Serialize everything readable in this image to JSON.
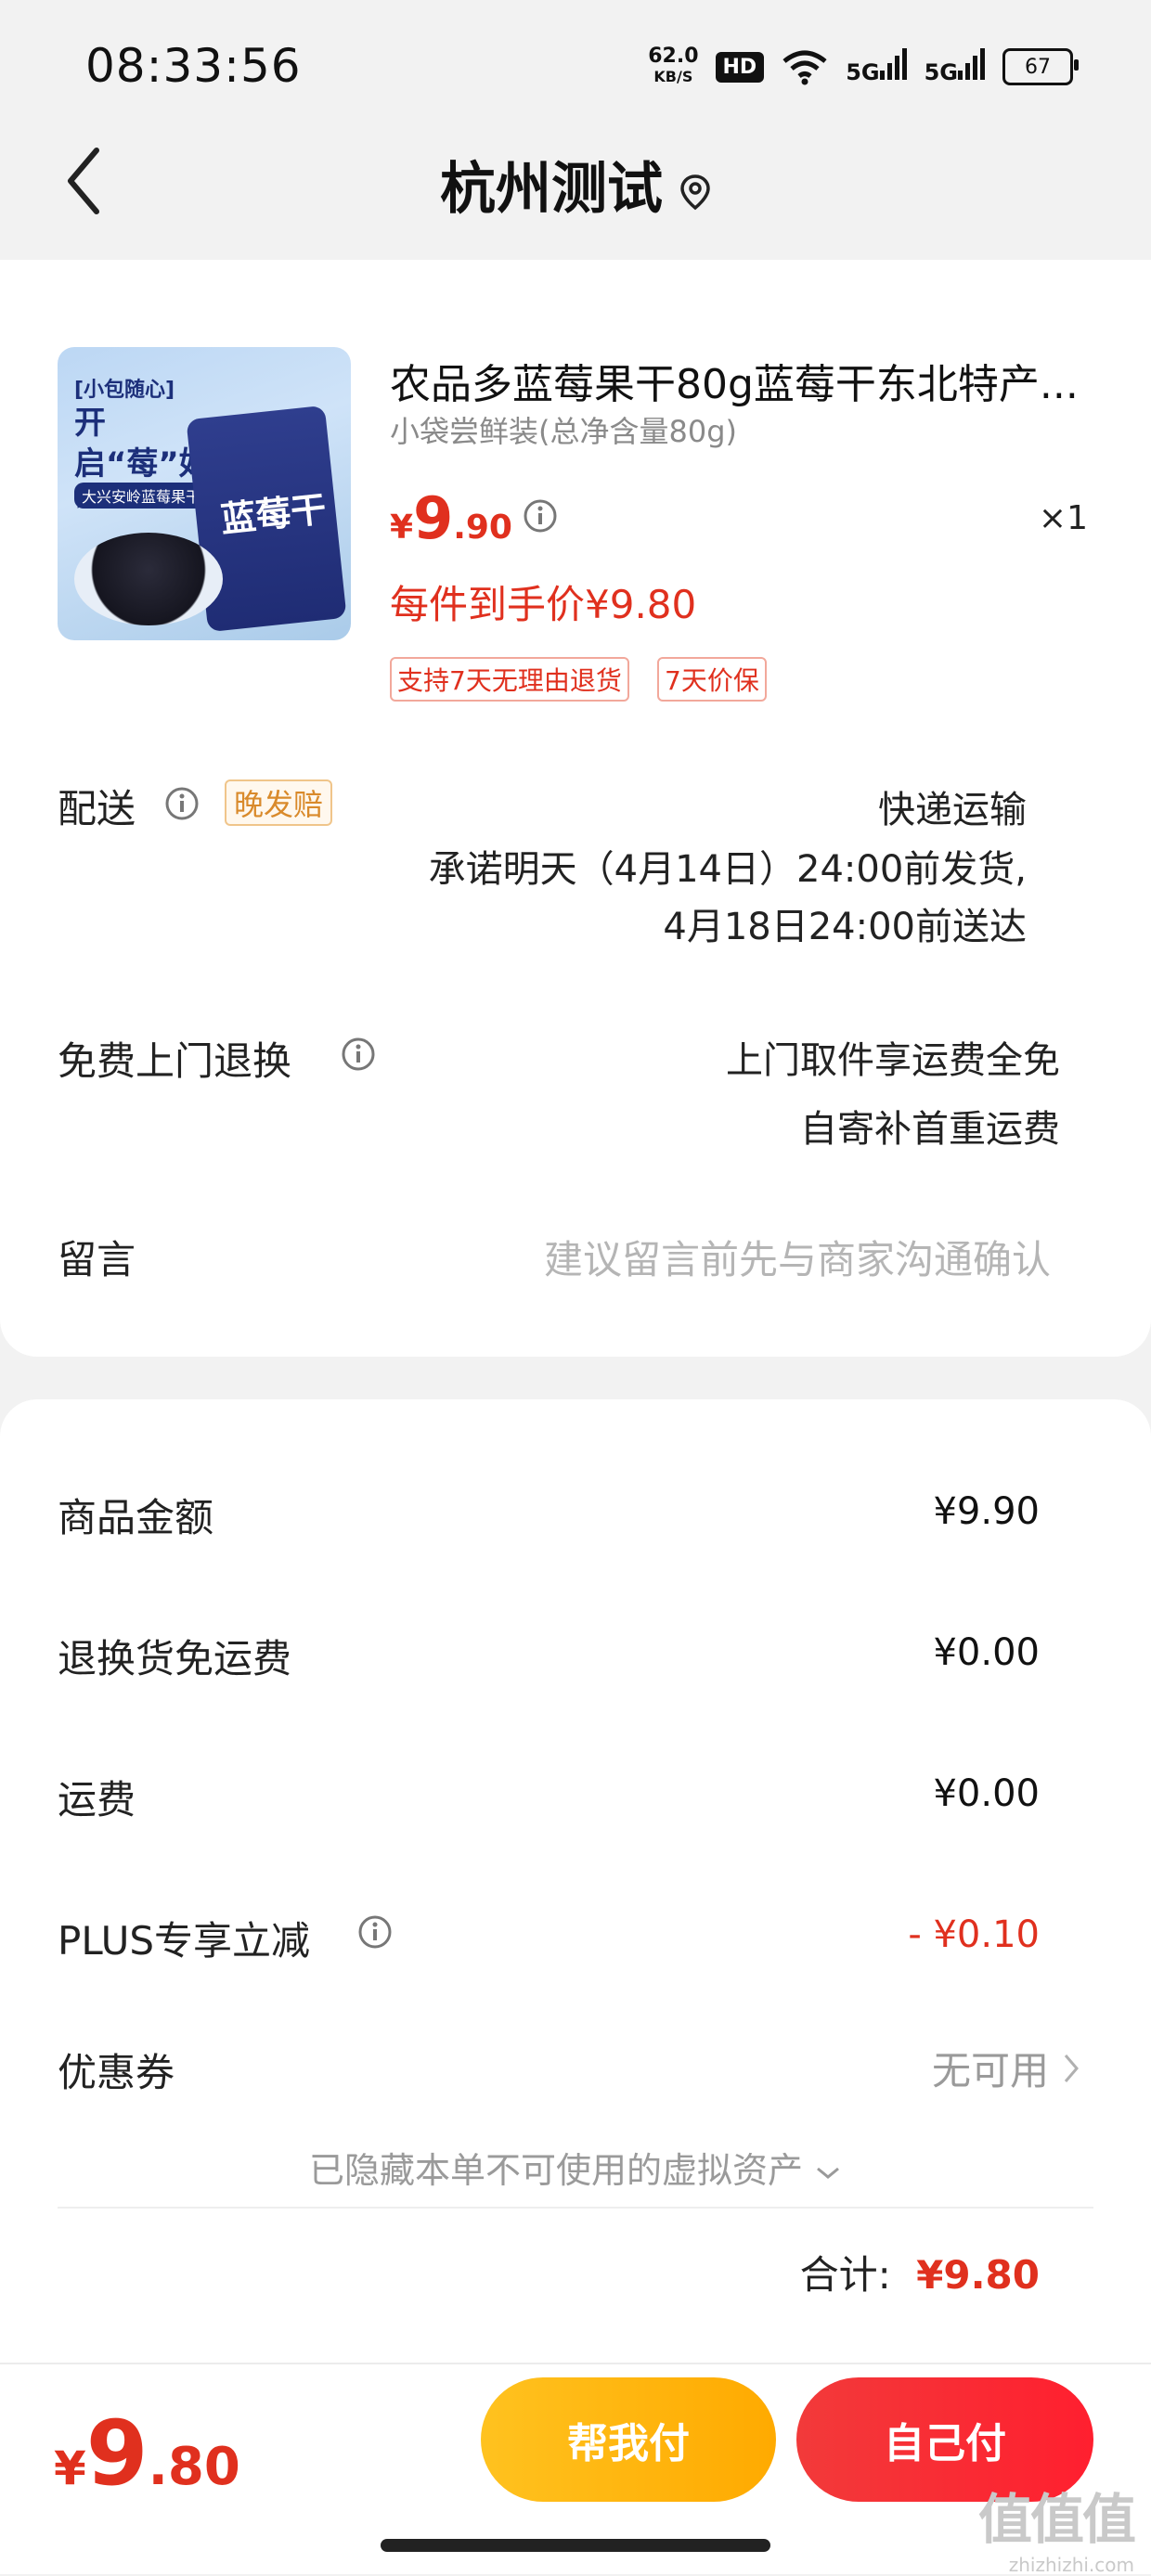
{
  "status_bar": {
    "time": "08:33:56",
    "net_speed_value": "62.0",
    "net_speed_unit": "KB/S",
    "hd": "HD",
    "signal1": "5G",
    "signal2": "5G",
    "battery": "67"
  },
  "nav": {
    "title": "杭州测试"
  },
  "product": {
    "title": "农品多蓝莓果干80g蓝莓干东北特产...",
    "spec": "小袋尝鲜装(总净含量80g)",
    "price_symbol": "¥",
    "price_int": "9",
    "price_dec": ".90",
    "qty": "×1",
    "final_price": "每件到手价¥9.80",
    "tags": [
      "支持7天无理由退货",
      "7天价保"
    ],
    "image": {
      "tag": "[小包随心]",
      "headline": "开启“莓”好~",
      "subline": "大兴安岭蓝莓果干",
      "bag_text": "蓝莓干"
    }
  },
  "delivery": {
    "label": "配送",
    "badge": "晚发赔",
    "method": "快递运输",
    "promise_line1": "承诺明天（4月14日）24:00前发货,",
    "promise_line2": "4月18日24:00前送达"
  },
  "return_service": {
    "label": "免费上门退换",
    "line1": "上门取件享运费全免",
    "line2": "自寄补首重运费"
  },
  "message": {
    "label": "留言",
    "placeholder": "建议留言前先与商家沟通确认"
  },
  "summary": {
    "rows": [
      {
        "label": "商品金额",
        "value": "¥9.90"
      },
      {
        "label": "退换货免运费",
        "value": "¥0.00"
      },
      {
        "label": "运费",
        "value": "¥0.00"
      },
      {
        "label": "PLUS专享立减",
        "value": "- ¥0.10"
      }
    ],
    "coupon_label": "优惠券",
    "coupon_value": "无可用",
    "hidden_assets": "已隐藏本单不可使用的虚拟资产",
    "total_label": "合计:",
    "total_value": "¥9.80"
  },
  "bottom_bar": {
    "price_symbol": "¥",
    "price_int": "9",
    "price_dec": ".80",
    "help_pay": "帮我付",
    "self_pay": "自己付"
  },
  "watermark": {
    "big": "值值值",
    "small": "zhizhizhi.com"
  },
  "colors": {
    "accent_red": "#e0301e",
    "button_yellow": "#ffb400",
    "button_red": "#f7283a"
  }
}
